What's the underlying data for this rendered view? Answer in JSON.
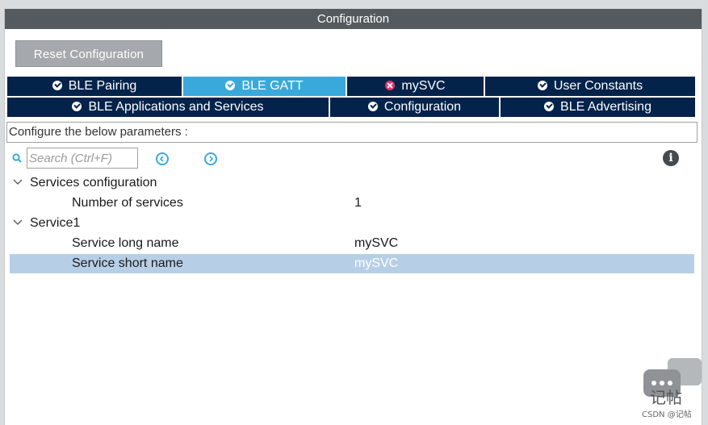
{
  "window": {
    "title": "Configuration"
  },
  "toolbar": {
    "reset_label": "Reset Configuration"
  },
  "tabs_row1": [
    {
      "label": "BLE Pairing",
      "status": "ok"
    },
    {
      "label": "BLE GATT",
      "status": "ok",
      "active": true
    },
    {
      "label": "mySVC",
      "status": "error"
    },
    {
      "label": "User Constants",
      "status": "ok"
    }
  ],
  "tabs_row2": [
    {
      "label": "BLE Applications and Services",
      "status": "ok"
    },
    {
      "label": "Configuration",
      "status": "ok"
    },
    {
      "label": "BLE Advertising",
      "status": "ok"
    }
  ],
  "params": {
    "description": "Configure the below parameters :"
  },
  "search": {
    "placeholder": "Search (Ctrl+F)"
  },
  "tree": {
    "group1": {
      "label": "Services configuration",
      "props": [
        {
          "label": "Number of services",
          "value": "1"
        }
      ]
    },
    "group2": {
      "label": "Service1",
      "props": [
        {
          "label": "Service long name",
          "value": "mySVC"
        },
        {
          "label": "Service short name",
          "value": "mySVC"
        }
      ]
    }
  },
  "watermark": {
    "text_main": "记帖",
    "text_small": "CSDN @记帖"
  },
  "colors": {
    "tab_bg": "#03234b",
    "tab_active": "#39a9dc",
    "error": "#e6336c",
    "selected_row": "#b7cfe6",
    "title_bar": "#555a5e"
  }
}
